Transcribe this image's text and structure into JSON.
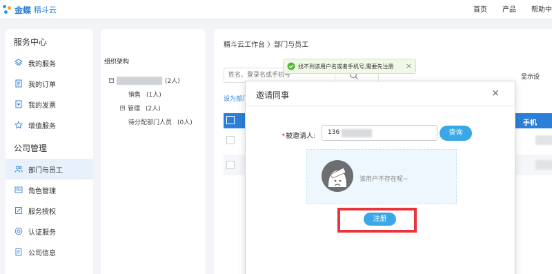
{
  "brand": {
    "name": "金蝶",
    "product": "精斗云"
  },
  "topnav": {
    "home": "首页",
    "product": "产品",
    "help": "帮助中"
  },
  "sidebar": {
    "group_service": "服务中心",
    "group_company": "公司管理",
    "items": [
      {
        "label": "我的服务",
        "icon": "layers-icon"
      },
      {
        "label": "我的订单",
        "icon": "document-icon"
      },
      {
        "label": "我的发票",
        "icon": "invoice-icon"
      },
      {
        "label": "增值服务",
        "icon": "star-icon"
      },
      {
        "label": "部门与员工",
        "icon": "users-icon",
        "active": true
      },
      {
        "label": "角色管理",
        "icon": "role-icon"
      },
      {
        "label": "服务授权",
        "icon": "edit-icon"
      },
      {
        "label": "认证服务",
        "icon": "verify-icon"
      },
      {
        "label": "公司信息",
        "icon": "company-icon"
      }
    ]
  },
  "org": {
    "title": "组织架构",
    "root_count": "(2人)",
    "nodes": [
      {
        "label": "销售",
        "count": "(1人)"
      },
      {
        "label": "管理",
        "count": "(2人)"
      },
      {
        "label": "待分配部门人员",
        "count": "(0人)"
      }
    ],
    "toggle_minus": "−",
    "toggle_plus": "+"
  },
  "main": {
    "breadcrumb": "精斗云工作台 〉部门与员工",
    "search_placeholder": "姓名、登录名或手机号",
    "show_settings": "显示设",
    "set_dept": "设为部门",
    "col_phone": "手机"
  },
  "dialog": {
    "title": "邀请同事",
    "close": "×",
    "invite_label": "被邀请人:",
    "required_mark": "*",
    "phone_value": "136",
    "query_btn": "查询",
    "not_found": "该用户不存在呢~",
    "register_btn": "注册"
  },
  "toast": {
    "text": "找不到该用户名或者手机号,需要先注册",
    "close": "×"
  },
  "colors": {
    "accent": "#2b7fd6",
    "button": "#3aa8e6",
    "highlight": "#e8343a",
    "toast_bg": "#f0f9e8"
  }
}
